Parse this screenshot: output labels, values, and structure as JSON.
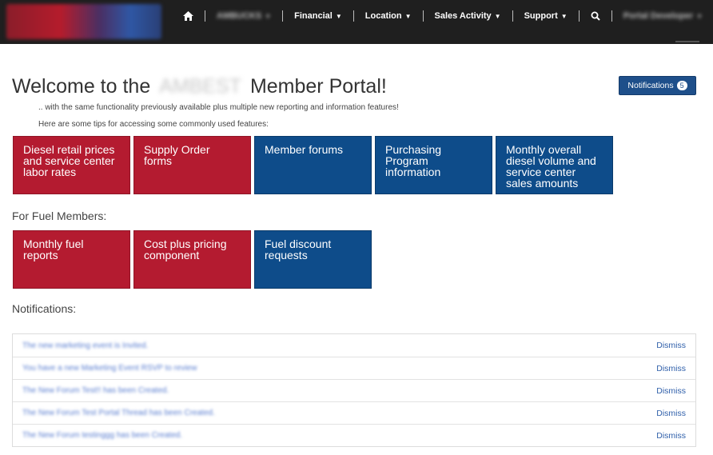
{
  "nav": {
    "items": [
      {
        "label": "AMBUCKS",
        "blurred": true,
        "caret": true
      },
      {
        "label": "Financial",
        "caret": true
      },
      {
        "label": "Location",
        "caret": true
      },
      {
        "label": "Sales Activity",
        "caret": true
      },
      {
        "label": "Support",
        "caret": true
      },
      {
        "label": "Portal Developer",
        "blurred": true,
        "caret": true
      }
    ]
  },
  "main": {
    "welcome_prefix": "Welcome to the",
    "welcome_redacted": "AMBEST",
    "welcome_suffix": "Member Portal!",
    "subtitle": ".. with the same functionality previously available plus multiple new reporting and information features!",
    "tips": "Here are some tips for accessing some commonly used features:",
    "notifications_button": "Notifications",
    "notifications_count": "5",
    "tiles": [
      {
        "label": "Diesel retail prices and service center labor rates",
        "color": "red"
      },
      {
        "label": "Supply Order forms",
        "color": "red"
      },
      {
        "label": "Member forums",
        "color": "blue"
      },
      {
        "label": "Purchasing Program information",
        "color": "blue"
      },
      {
        "label": "Monthly overall diesel volume and service center sales amounts",
        "color": "blue"
      }
    ],
    "fuel_heading": "For Fuel Members:",
    "fuel_tiles": [
      {
        "label": "Monthly fuel reports",
        "color": "red"
      },
      {
        "label": "Cost plus pricing component",
        "color": "red"
      },
      {
        "label": "Fuel discount requests",
        "color": "blue"
      }
    ],
    "notifications_heading": "Notifications:",
    "notifications": [
      {
        "text": "The new marketing event is Invited.",
        "action": "Dismiss"
      },
      {
        "text": "You have a new Marketing Event RSVP to review",
        "action": "Dismiss"
      },
      {
        "text": "The New Forum Test!! has been Created.",
        "action": "Dismiss"
      },
      {
        "text": "The New Forum Test Portal Thread has been Created.",
        "action": "Dismiss"
      },
      {
        "text": "The New Forum testinggg has been Created.",
        "action": "Dismiss"
      }
    ]
  },
  "colors": {
    "red": "#b41b30",
    "blue": "#0e4c8a",
    "topbar": "#1f1f1f"
  }
}
